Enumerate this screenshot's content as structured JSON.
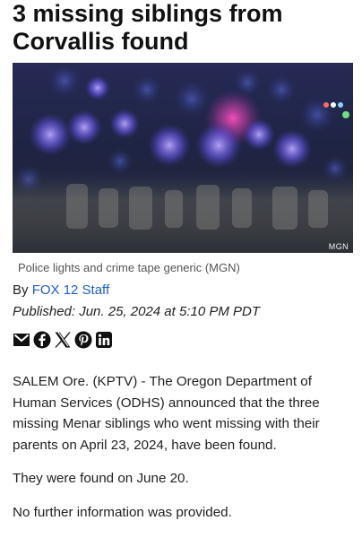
{
  "article": {
    "headline": "3 missing siblings from Corvallis found",
    "image": {
      "credit": "MGN",
      "caption": "Police lights and crime tape generic  (MGN)"
    },
    "byline": {
      "prefix": "By",
      "author": "FOX 12 Staff"
    },
    "published": "Published: Jun. 25, 2024 at 5:10 PM PDT",
    "share_icons": [
      "email-icon",
      "facebook-icon",
      "x-icon",
      "pinterest-icon",
      "linkedin-icon"
    ],
    "paragraphs": [
      "SALEM Ore. (KPTV) - The Oregon Department of Human Services (ODHS) announced that the three missing Menar siblings who went missing with their parents on April 23, 2024, have been found.",
      "They were found on June 20.",
      "No further information was provided."
    ]
  },
  "colors": {
    "author_link": "#1f5fbf",
    "text": "#222222",
    "caption": "#555555"
  }
}
